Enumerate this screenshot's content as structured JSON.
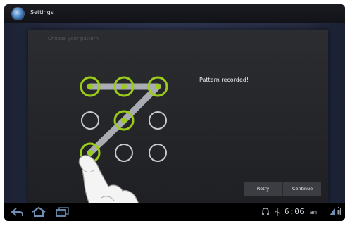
{
  "app": {
    "title": "Settings",
    "icon": "settings-icon"
  },
  "dialog": {
    "header": "Choose your pattern",
    "message": "Pattern recorded!",
    "buttons": {
      "retry": "Retry",
      "continue": "Continue"
    }
  },
  "pattern": {
    "grid_rows": 3,
    "grid_cols": 3,
    "sequence": [
      0,
      1,
      2,
      4,
      6
    ],
    "active_color": "#9ccc1a",
    "line_color": "#b8bcc2"
  },
  "system_bar": {
    "time": "6:06",
    "ampm": "am",
    "icons": [
      "back-icon",
      "home-icon",
      "recent-apps-icon",
      "headset-icon",
      "usb-icon",
      "wifi-icon",
      "battery-icon"
    ]
  }
}
